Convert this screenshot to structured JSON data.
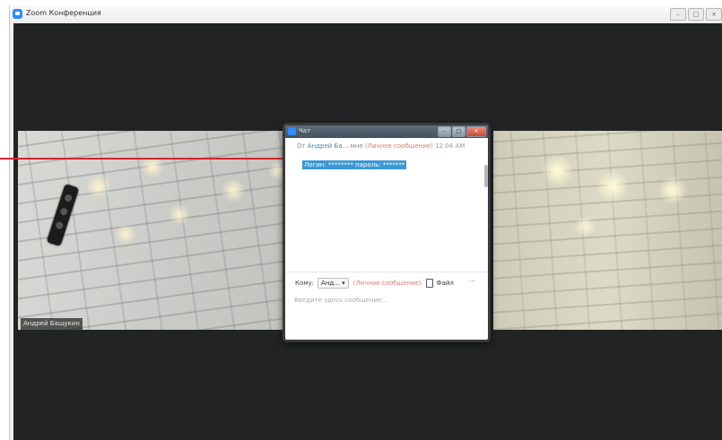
{
  "window": {
    "title": "Zoom Конференция",
    "controls": [
      "–",
      "□",
      "×"
    ]
  },
  "video": {
    "left_participant": "Андрей Бащукин"
  },
  "chat": {
    "title": "Чат",
    "controls": [
      "–",
      "□",
      "×"
    ],
    "header": {
      "from": "От",
      "sender": "Андрей Ба...",
      "to_me": "мне",
      "private": "(Личное сообщение)",
      "time": "12:04 AM"
    },
    "message": "Логин: ******** пароль: *******",
    "to_label": "Кому:",
    "to_value": "Анд... ▾",
    "to_private": "(Личное сообщение)",
    "file_label": "Файл",
    "more": "···",
    "input_placeholder": "Введите здесь сообщение..."
  },
  "colors": {
    "accent": "#2d8cff",
    "highlight": "#3a97d8",
    "annotation_arrow": "#d8262b",
    "private_label": "#e07a6a",
    "stage_background": "#222424"
  },
  "icons": [
    "zoom-logo-icon",
    "file-icon",
    "arrow-annotation"
  ]
}
